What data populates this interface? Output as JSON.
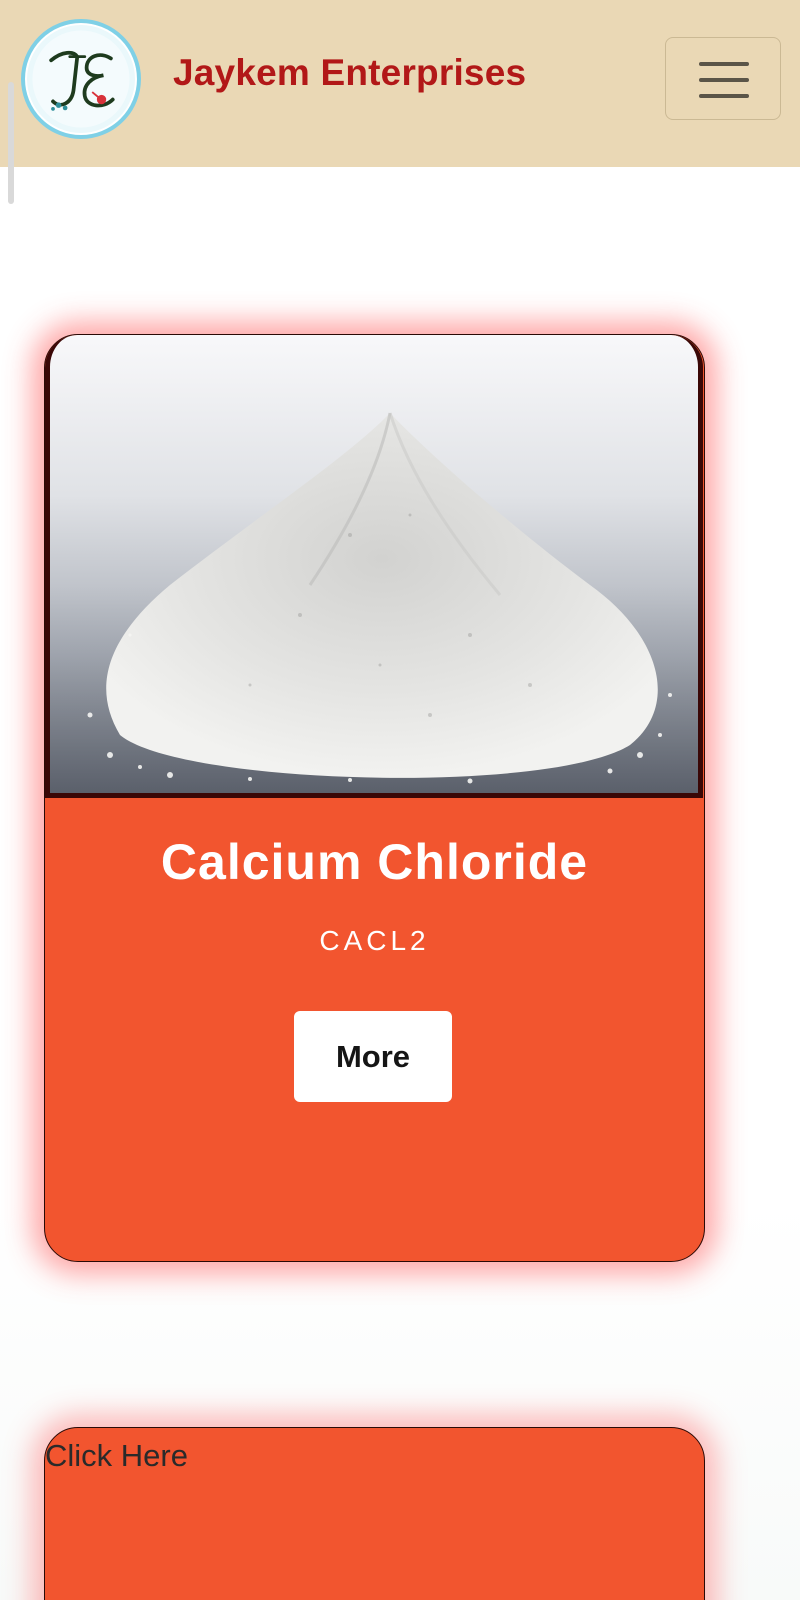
{
  "header": {
    "brand_name": "Jaykem Enterprises",
    "logo_icon": "je-monogram-logo",
    "menu_icon": "hamburger-menu-icon",
    "brand_color": "#b21818",
    "background_color": "#ead8b5"
  },
  "product_card": {
    "image_icon": "calcium-chloride-powder-image",
    "title": "Calcium Chloride",
    "formula": "CACL2",
    "button_label": "More",
    "card_color": "#f2552f"
  },
  "second_card": {
    "link_text": "Click Here"
  }
}
